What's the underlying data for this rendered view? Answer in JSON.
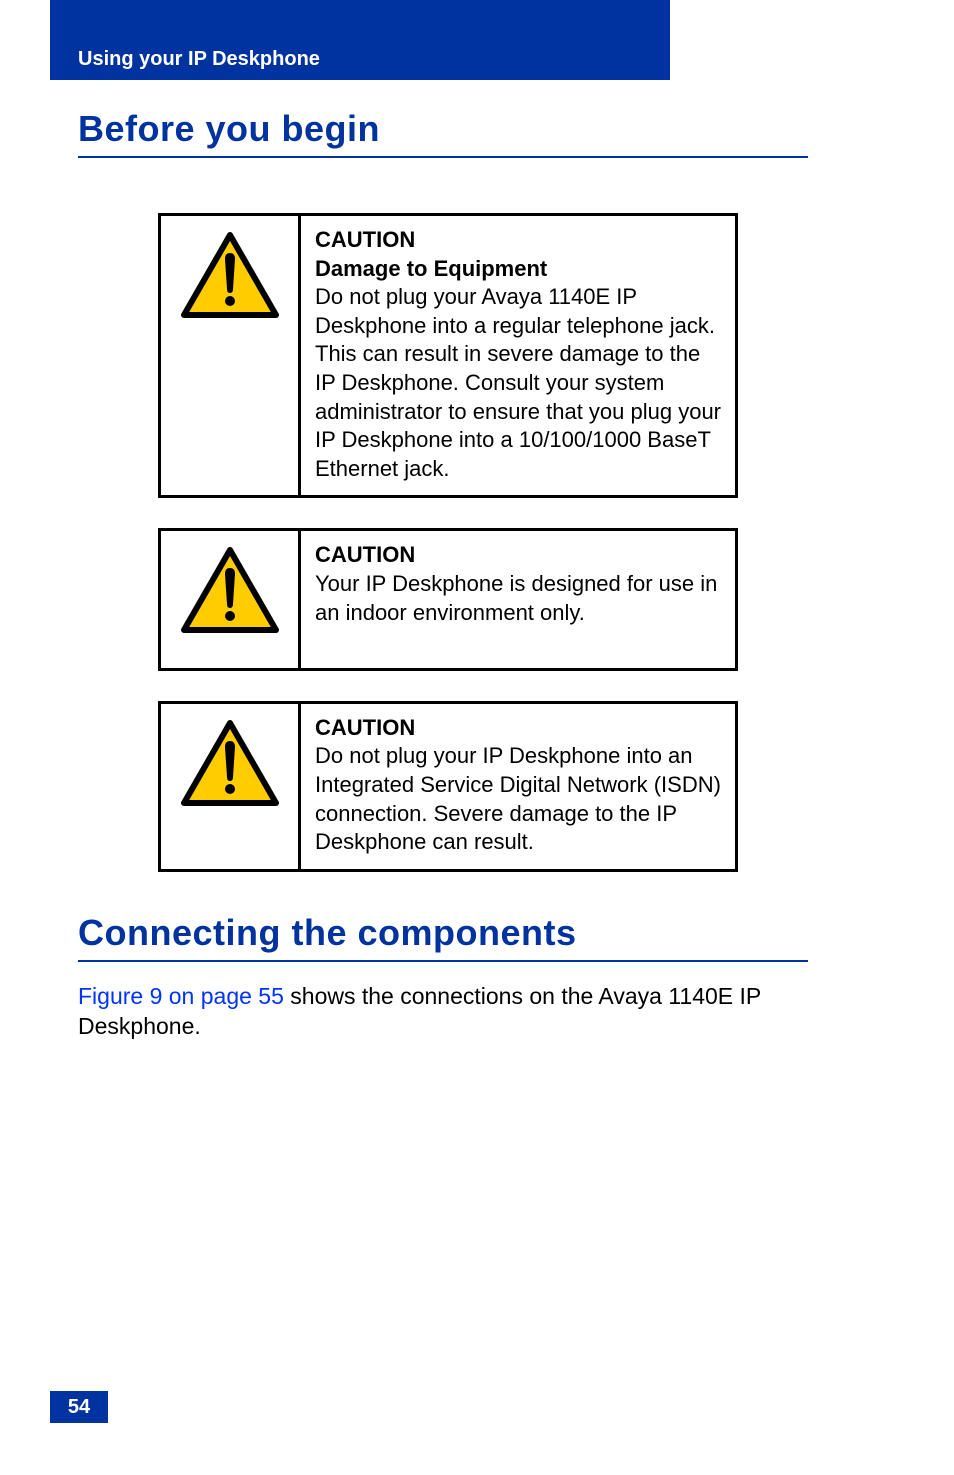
{
  "header": {
    "section": "Using your IP Deskphone"
  },
  "headings": {
    "before_you_begin": "Before you begin",
    "connecting_components": "Connecting the components"
  },
  "cautions": [
    {
      "title": "CAUTION",
      "subtitle": "Damage to Equipment",
      "body": "Do not plug your Avaya 1140E IP Deskphone into a regular telephone jack. This can result in severe damage to the IP Deskphone. Consult your system administrator to ensure that you plug your IP Deskphone into a 10/100/1000 BaseT Ethernet jack."
    },
    {
      "title": "CAUTION",
      "subtitle": "",
      "body": "Your IP Deskphone is designed for use in an indoor environment only."
    },
    {
      "title": "CAUTION",
      "subtitle": "",
      "body": "Do not plug your IP Deskphone into an Integrated Service Digital Network (ISDN) connection. Severe damage to the IP Deskphone can result."
    }
  ],
  "body_paragraph": {
    "link_text": "Figure 9 on page 55",
    "rest_text": " shows the connections on the Avaya 1140E IP Deskphone."
  },
  "page_number": "54"
}
